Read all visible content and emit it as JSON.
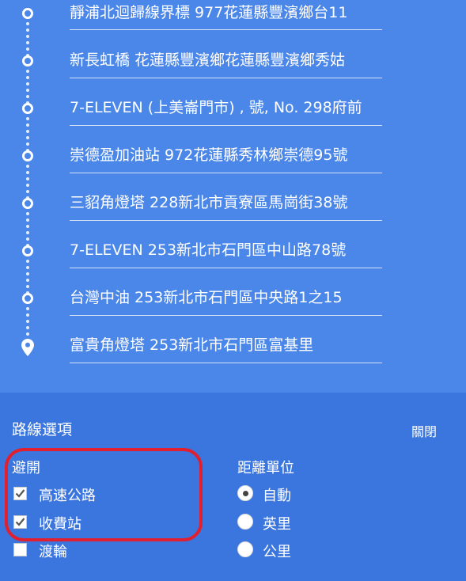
{
  "waypoints": [
    {
      "label": "靜浦北迴歸線界標 977花蓮縣豐濱鄉台11"
    },
    {
      "label": "新長虹橋 花蓮縣豐濱鄉花蓮縣豐濱鄉秀姑"
    },
    {
      "label": "7-ELEVEN (上美崙門市) , 號, No. 298府前"
    },
    {
      "label": "崇德盈加油站 972花蓮縣秀林鄉崇德95號"
    },
    {
      "label": "三貂角燈塔 228新北市貢寮區馬崗街38號"
    },
    {
      "label": "7-ELEVEN 253新北市石門區中山路78號"
    },
    {
      "label": "台灣中油 253新北市石門區中央路1之15"
    },
    {
      "label": "富貴角燈塔 253新北市石門區富基里"
    }
  ],
  "route_options": {
    "title": "路線選項",
    "close_label": "關閉",
    "avoid": {
      "heading": "避開",
      "items": [
        {
          "label": "高速公路",
          "checked": true
        },
        {
          "label": "收費站",
          "checked": true
        },
        {
          "label": "渡輪",
          "checked": false
        }
      ]
    },
    "distance_units": {
      "heading": "距離單位",
      "items": [
        {
          "label": "自動",
          "selected": true
        },
        {
          "label": "英里",
          "selected": false
        },
        {
          "label": "公里",
          "selected": false
        }
      ]
    }
  },
  "colors": {
    "background": "#4b87e8",
    "panel": "#3b76de",
    "highlight": "#e02030"
  }
}
